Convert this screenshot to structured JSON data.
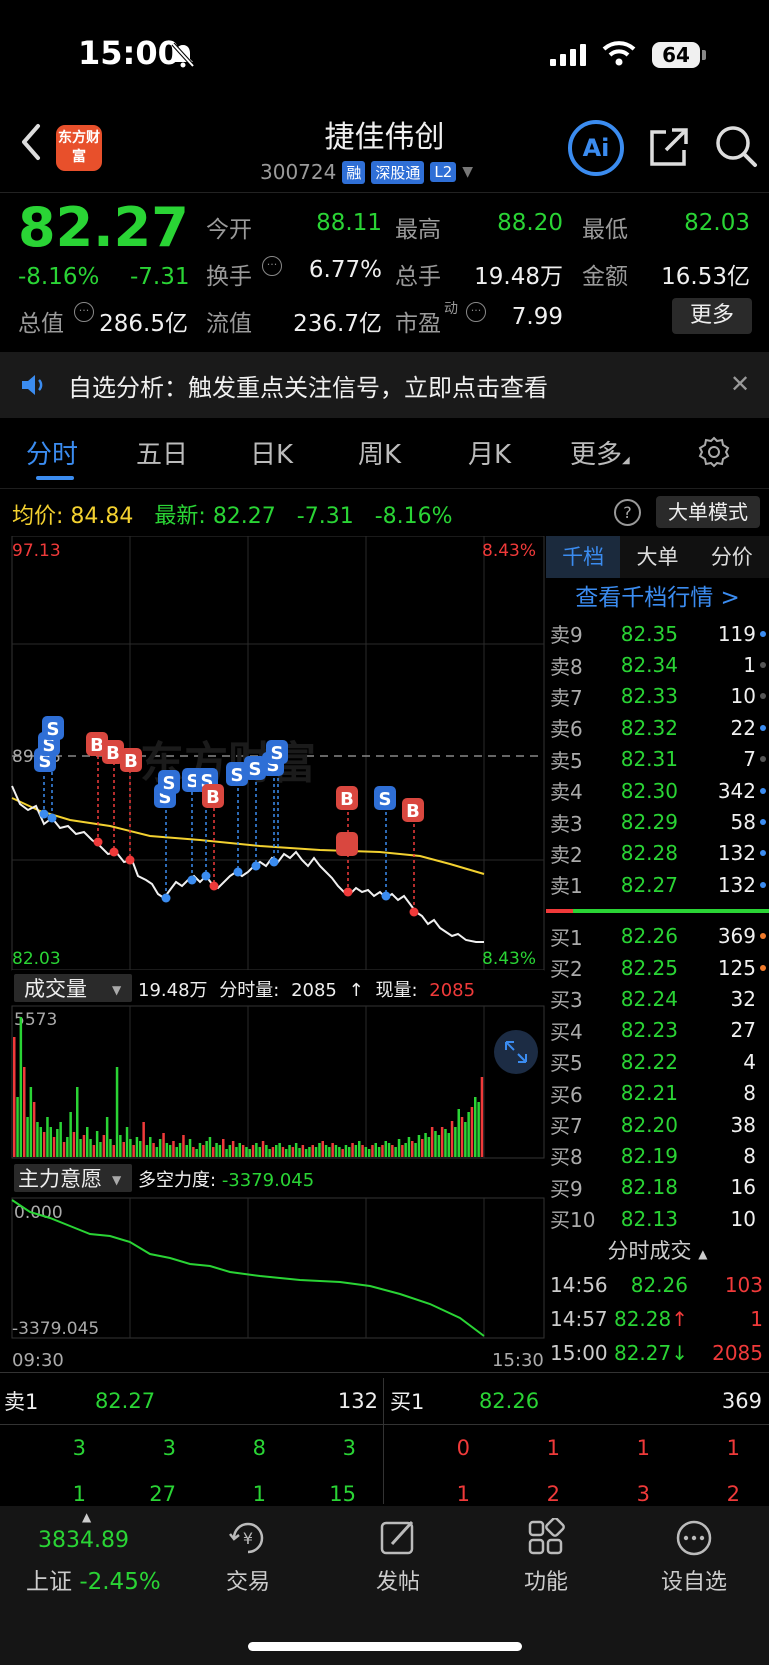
{
  "status_bar": {
    "time": "15:00",
    "battery": "64"
  },
  "header": {
    "logo_text": "东方财富",
    "stock_name": "捷佳伟创",
    "stock_code": "300724",
    "tags": [
      "融",
      "深股通",
      "L2"
    ],
    "ai_label": "Ai"
  },
  "quote": {
    "price": "82.27",
    "change_pct": "-8.16%",
    "change": "-7.31",
    "stats": [
      {
        "label": "今开",
        "value": "88.11",
        "color": "#2ad435"
      },
      {
        "label": "最高",
        "value": "88.20",
        "color": "#2ad435"
      },
      {
        "label": "最低",
        "value": "82.03",
        "color": "#2ad435"
      },
      {
        "label": "换手",
        "value": "6.77%",
        "color": "#f0f0f0"
      },
      {
        "label": "总手",
        "value": "19.48万",
        "color": "#f0f0f0"
      },
      {
        "label": "金额",
        "value": "16.53亿",
        "color": "#f0f0f0"
      },
      {
        "label": "总值",
        "value": "286.5亿",
        "color": "#f0f0f0"
      },
      {
        "label": "流值",
        "value": "236.7亿",
        "color": "#f0f0f0"
      },
      {
        "label": "市盈",
        "value": "7.99",
        "color": "#f0f0f0"
      }
    ],
    "pe_superscript": "动",
    "more_label": "更多"
  },
  "notice": {
    "text": "自选分析：触发重点关注信号，立即点击查看"
  },
  "tabs": [
    "分时",
    "五日",
    "日K",
    "周K",
    "月K",
    "更多"
  ],
  "info_row": {
    "avg_label": "均价:",
    "avg_value": "84.84",
    "latest_label": "最新:",
    "latest_value": "82.27",
    "latest_change": "-7.31",
    "latest_pct": "-8.16%",
    "big_order_mode": "大单模式"
  },
  "chart": {
    "y_top": "97.13",
    "y_mid": "89.58",
    "y_bottom": "82.03",
    "pct_top": "8.43%",
    "pct_bottom": "8.43%",
    "watermark": "东方财富",
    "volume_label": "成交量",
    "volume_info_total": "19.48万",
    "volume_info_fenshi_label": "分时量:",
    "volume_info_fenshi": "2085",
    "volume_info_xian_label": "现量:",
    "volume_info_xian": "2085",
    "volume_max": "5573",
    "main_force_label": "主力意愿",
    "main_force_info_label": "多空力度:",
    "main_force_info_value": "-3379.045",
    "mf_top": "0.000",
    "mf_bottom": "-3379.045",
    "time_start": "09:30",
    "time_end": "15:30"
  },
  "order_book": {
    "tabs": [
      "千档",
      "大单",
      "分价"
    ],
    "view_link": "查看千档行情 >",
    "asks": [
      {
        "label": "卖9",
        "price": "82.35",
        "vol": "119",
        "dot": "#3b8cf0"
      },
      {
        "label": "卖8",
        "price": "82.34",
        "vol": "1",
        "dot": "#555"
      },
      {
        "label": "卖7",
        "price": "82.33",
        "vol": "10",
        "dot": "#555"
      },
      {
        "label": "卖6",
        "price": "82.32",
        "vol": "22",
        "dot": "#3b8cf0"
      },
      {
        "label": "卖5",
        "price": "82.31",
        "vol": "7",
        "dot": "#555"
      },
      {
        "label": "卖4",
        "price": "82.30",
        "vol": "342",
        "dot": "#3b8cf0"
      },
      {
        "label": "卖3",
        "price": "82.29",
        "vol": "58",
        "dot": "#3b8cf0"
      },
      {
        "label": "卖2",
        "price": "82.28",
        "vol": "132",
        "dot": "#3b8cf0"
      },
      {
        "label": "卖1",
        "price": "82.27",
        "vol": "132",
        "dot": "#3b8cf0"
      }
    ],
    "bids": [
      {
        "label": "买1",
        "price": "82.26",
        "vol": "369",
        "dot": "#f07a2a"
      },
      {
        "label": "买2",
        "price": "82.25",
        "vol": "125",
        "dot": "#f07a2a"
      },
      {
        "label": "买3",
        "price": "82.24",
        "vol": "32",
        "dot": ""
      },
      {
        "label": "买4",
        "price": "82.23",
        "vol": "27",
        "dot": ""
      },
      {
        "label": "买5",
        "price": "82.22",
        "vol": "4",
        "dot": ""
      },
      {
        "label": "买6",
        "price": "82.21",
        "vol": "8",
        "dot": ""
      },
      {
        "label": "买7",
        "price": "82.20",
        "vol": "38",
        "dot": ""
      },
      {
        "label": "买8",
        "price": "82.19",
        "vol": "8",
        "dot": ""
      },
      {
        "label": "买9",
        "price": "82.18",
        "vol": "16",
        "dot": ""
      },
      {
        "label": "买10",
        "price": "82.13",
        "vol": "10",
        "dot": ""
      }
    ],
    "trades_title": "分时成交",
    "trades": [
      {
        "time": "14:56",
        "price": "82.26",
        "arrow": "",
        "vol": "103"
      },
      {
        "time": "14:57",
        "price": "82.28",
        "arrow": "↑",
        "vol": "1"
      },
      {
        "time": "15:00",
        "price": "82.27",
        "arrow": "↓",
        "vol": "2085"
      }
    ]
  },
  "level1": {
    "sell_label": "卖1",
    "sell_price": "82.27",
    "sell_vol": "132",
    "buy_label": "买1",
    "buy_price": "82.26",
    "buy_vol": "369",
    "sell_queue_row1": [
      "3",
      "3",
      "8",
      "3"
    ],
    "sell_queue_row2": [
      "1",
      "27",
      "1",
      "15"
    ],
    "buy_queue_row1": [
      "0",
      "1",
      "1",
      "1"
    ],
    "buy_queue_row2": [
      "1",
      "2",
      "3",
      "2"
    ]
  },
  "bottom_nav": {
    "index_value": "3834.89",
    "index_name": "上证",
    "index_pct": "-2.45%",
    "items": [
      "交易",
      "发帖",
      "功能",
      "设自选"
    ]
  }
}
